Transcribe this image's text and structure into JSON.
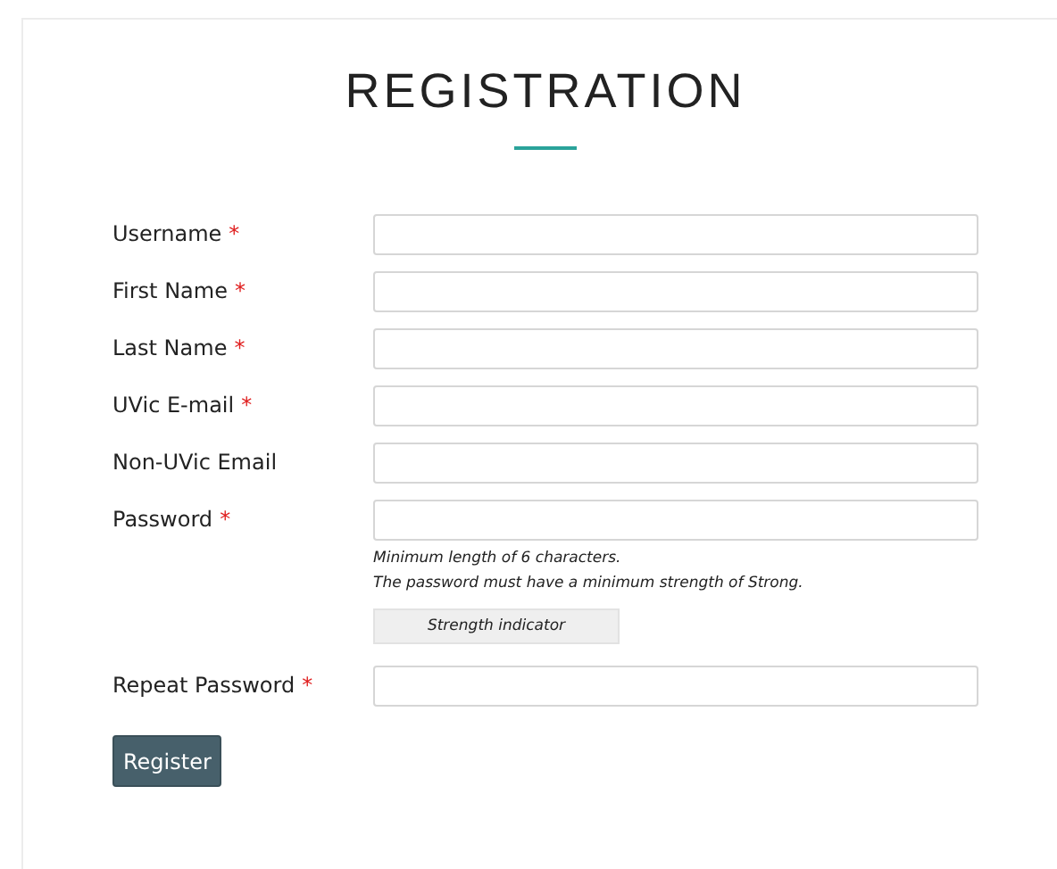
{
  "title": "REGISTRATION",
  "fields": [
    {
      "label": "Username",
      "required_mark": "*"
    },
    {
      "label": "First Name",
      "required_mark": "*"
    },
    {
      "label": "Last Name",
      "required_mark": "*"
    },
    {
      "label": "UVic E-mail",
      "required_mark": "*"
    },
    {
      "label": "Non-UVic Email"
    },
    {
      "label": "Password",
      "required_mark": "*",
      "hints": [
        "Minimum length of 6 characters.",
        "The password must have a minimum strength of Strong."
      ],
      "strength_indicator": "Strength indicator"
    },
    {
      "label": "Repeat Password",
      "required_mark": "*"
    }
  ],
  "submit_button": "Register"
}
